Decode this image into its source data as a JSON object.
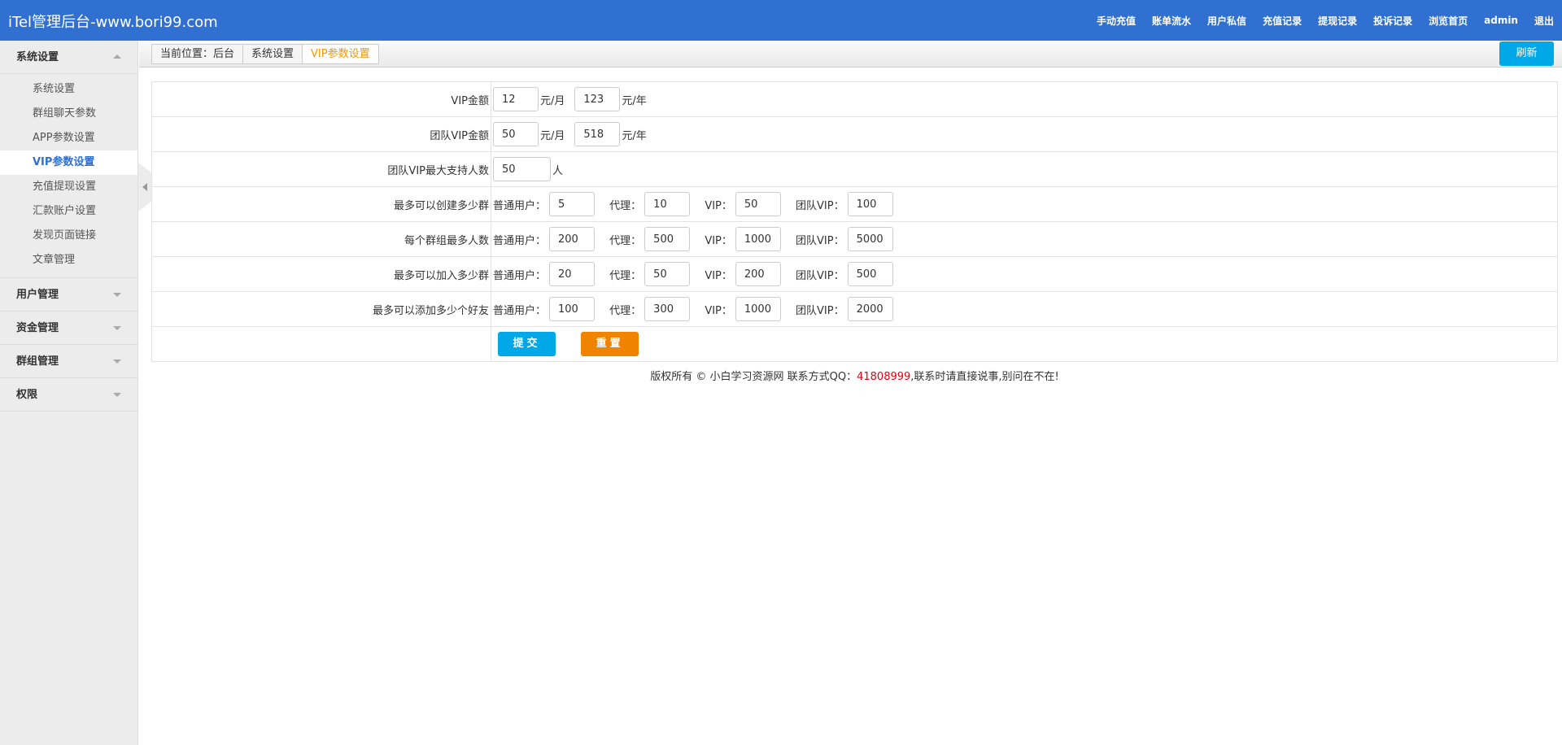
{
  "header": {
    "brand": "iTel管理后台-www.bori99.com",
    "nav": [
      "手动充值",
      "账单流水",
      "用户私信",
      "充值记录",
      "提现记录",
      "投诉记录",
      "浏览首页",
      "admin",
      "退出"
    ]
  },
  "sidebar": {
    "groups": [
      {
        "label": "系统设置",
        "expanded": true,
        "items": [
          "系统设置",
          "群组聊天参数",
          "APP参数设置",
          "VIP参数设置",
          "充值提现设置",
          "汇款账户设置",
          "发现页面链接",
          "文章管理"
        ],
        "active_index": 3
      },
      {
        "label": "用户管理",
        "expanded": false
      },
      {
        "label": "资金管理",
        "expanded": false
      },
      {
        "label": "群组管理",
        "expanded": false
      },
      {
        "label": "权限",
        "expanded": false
      }
    ]
  },
  "breadcrumb": {
    "prefix": "当前位置：后台",
    "level1": "系统设置",
    "current": "VIP参数设置"
  },
  "toolbar": {
    "refresh_label": "刷新"
  },
  "form": {
    "vip_amount": {
      "label": "VIP金额",
      "month": "12",
      "month_unit": "元/月",
      "year": "123",
      "year_unit": "元/年"
    },
    "team_vip_amount": {
      "label": "团队VIP金额",
      "month": "50",
      "month_unit": "元/月",
      "year": "518",
      "year_unit": "元/年"
    },
    "team_vip_max": {
      "label": "团队VIP最大支持人数",
      "value": "50",
      "unit": "人"
    },
    "tier_labels": {
      "normal": "普通用户：",
      "agent": "代理：",
      "vip": "VIP：",
      "team_vip": "团队VIP："
    },
    "create_groups": {
      "label": "最多可以创建多少群",
      "normal": "5",
      "agent": "10",
      "vip": "50",
      "team_vip": "100"
    },
    "group_members": {
      "label": "每个群组最多人数",
      "normal": "200",
      "agent": "500",
      "vip": "1000",
      "team_vip": "5000"
    },
    "join_groups": {
      "label": "最多可以加入多少群",
      "normal": "20",
      "agent": "50",
      "vip": "200",
      "team_vip": "500"
    },
    "add_friends": {
      "label": "最多可以添加多少个好友",
      "normal": "100",
      "agent": "300",
      "vip": "1000",
      "team_vip": "2000"
    },
    "submit_label": "提交",
    "reset_label": "重置"
  },
  "footer": {
    "prefix": "版权所有 © 小白学习资源网 联系方式QQ：",
    "qq": "41808999",
    "suffix": ",联系时请直接说事,别问在不在!"
  }
}
